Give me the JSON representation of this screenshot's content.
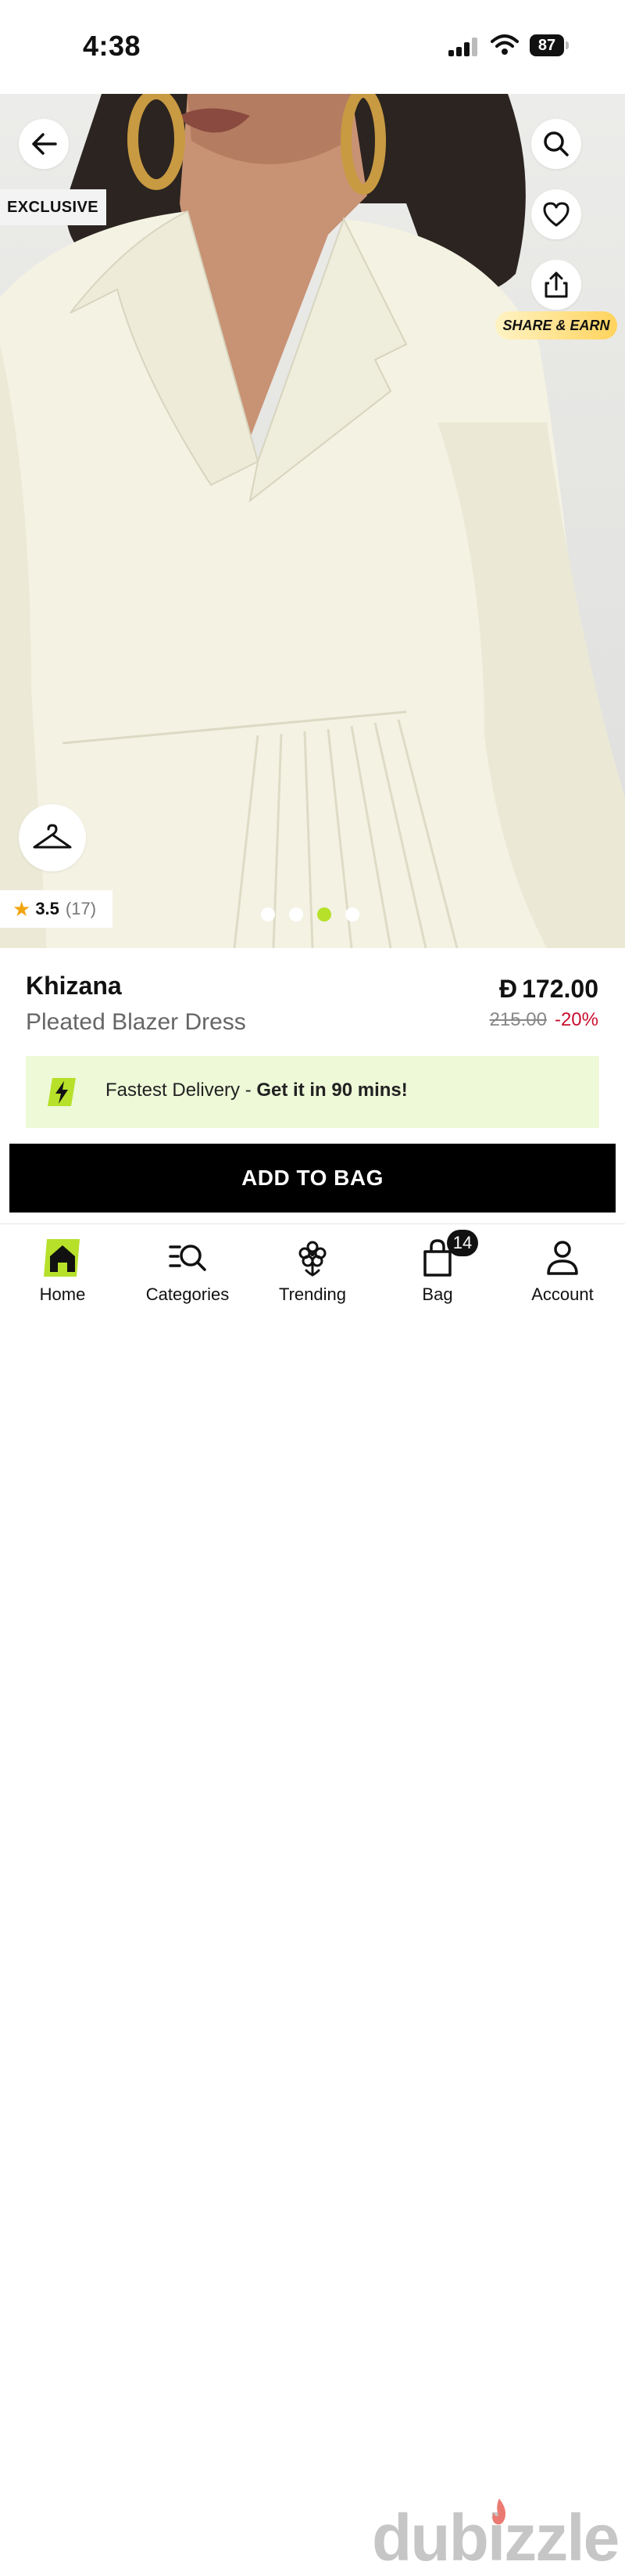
{
  "status_bar": {
    "time": "4:38",
    "battery": "87"
  },
  "hero": {
    "exclusive_label": "EXCLUSIVE",
    "share_earn_label": "SHARE & EARN",
    "rating": {
      "score": "3.5",
      "count": "(17)"
    },
    "carousel": {
      "total": 4,
      "active_index": 2
    }
  },
  "product": {
    "brand": "Khizana",
    "name": "Pleated Blazer Dress",
    "currency_symbol": "Đ",
    "price": "172.00",
    "old_price": "215.00",
    "discount": "-20%"
  },
  "delivery": {
    "prefix": "Fastest Delivery - ",
    "highlight": "Get it in 90 mins!"
  },
  "cta": {
    "add_to_bag": "ADD TO BAG"
  },
  "nav": {
    "items": [
      {
        "label": "Home",
        "icon": "home-icon"
      },
      {
        "label": "Categories",
        "icon": "categories-icon"
      },
      {
        "label": "Trending",
        "icon": "trending-icon"
      },
      {
        "label": "Bag",
        "icon": "bag-icon"
      },
      {
        "label": "Account",
        "icon": "account-icon"
      }
    ],
    "bag_badge": "14"
  },
  "watermark": "dubizzle",
  "colors": {
    "accent_green": "#b6e02a",
    "discount_red": "#c8102e",
    "delivery_bg": "#eef9d8"
  }
}
